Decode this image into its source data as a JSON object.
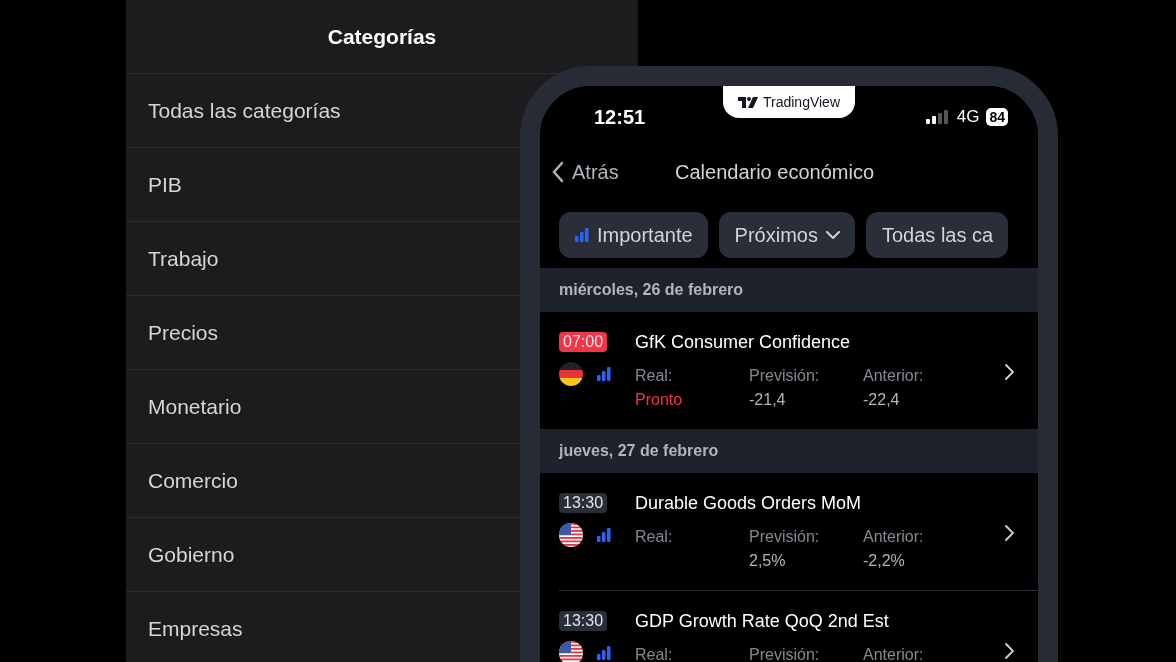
{
  "categories_panel": {
    "title": "Categorías",
    "items": [
      {
        "label": "Todas las categorías"
      },
      {
        "label": "PIB"
      },
      {
        "label": "Trabajo"
      },
      {
        "label": "Precios"
      },
      {
        "label": "Monetario"
      },
      {
        "label": "Comercio"
      },
      {
        "label": "Gobierno"
      },
      {
        "label": "Empresas"
      }
    ]
  },
  "phone": {
    "notch_brand": "TradingView",
    "status_bar": {
      "time": "12:51",
      "network": "4G",
      "battery": "84"
    },
    "nav": {
      "back": "Atrás",
      "title": "Calendario económico"
    },
    "filters": [
      {
        "label": "Importante",
        "kind": "importance"
      },
      {
        "label": "Próximos",
        "kind": "dropdown"
      },
      {
        "label": "Todas las ca",
        "kind": "plain"
      }
    ],
    "days": [
      {
        "date": "miércoles, 26 de febrero",
        "events": [
          {
            "time": "07:00",
            "color": "#f23645",
            "kind": "de",
            "title": "GfK Consumer Confidence",
            "actual_label": "Real:",
            "actual": "Pronto",
            "forecast_label": "Previsión:",
            "forecast": "-21,4",
            "previous_label": "Anterior:",
            "previous": "-22,4"
          }
        ]
      },
      {
        "date": "jueves, 27 de febrero",
        "events": [
          {
            "time": "13:30",
            "color": "#2a2e39",
            "kind": "us",
            "title": "Durable Goods Orders MoM",
            "actual_label": "Real:",
            "forecast_label": "Previsión:",
            "forecast": "2,5%",
            "previous_label": "Anterior:",
            "previous": "-2,2%"
          },
          {
            "time": "13:30",
            "color": "#2a2e39",
            "kind": "us",
            "title": "GDP Growth Rate QoQ 2nd Est",
            "actual_label": "Real:",
            "forecast_label": "Previsión:",
            "previous_label": "Anterior:"
          }
        ]
      }
    ]
  }
}
